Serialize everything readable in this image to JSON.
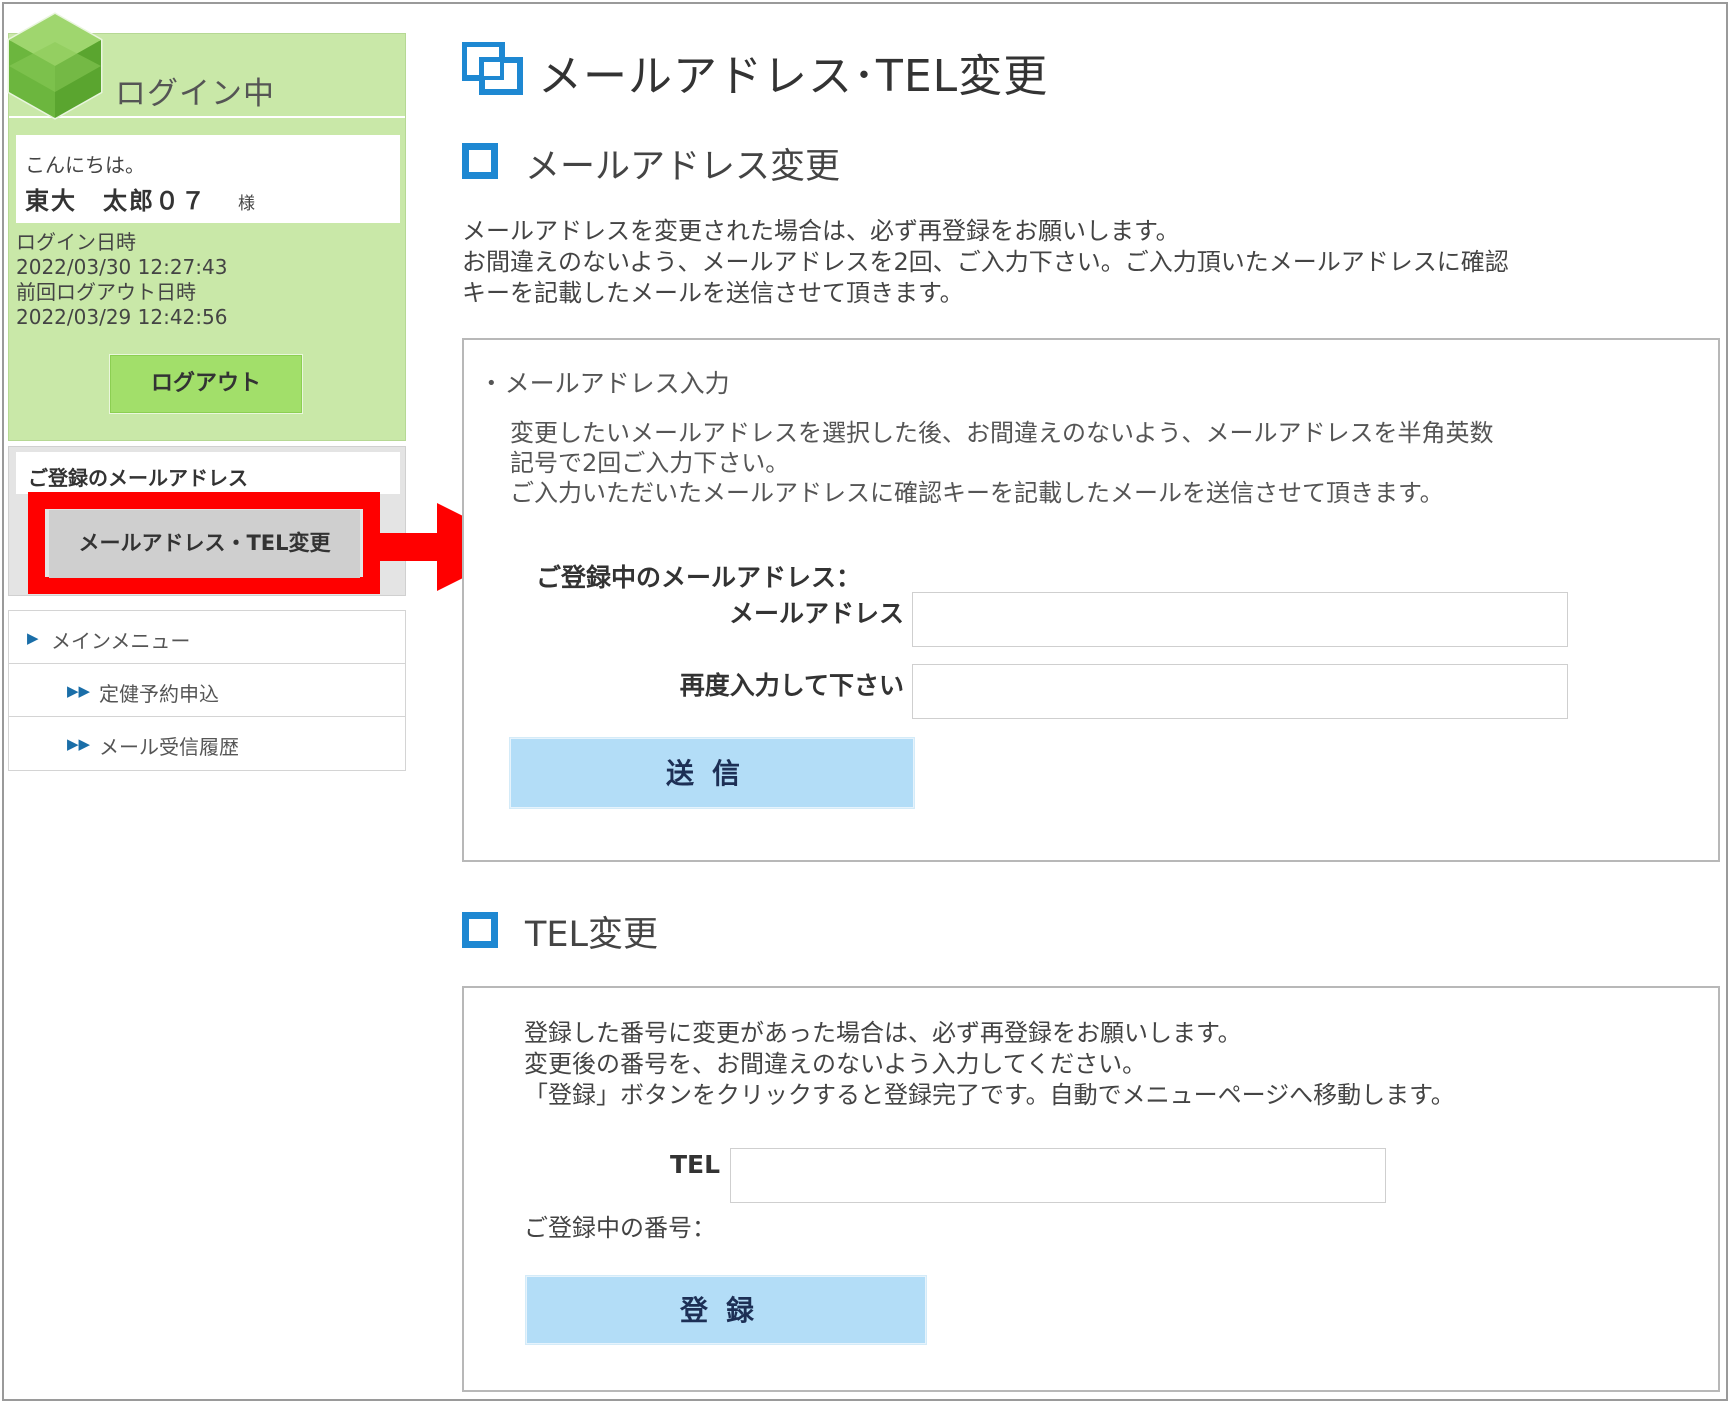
{
  "sidebar": {
    "login_title": "ログイン中",
    "greeting": "こんにちは。",
    "user_name": "東大　太郎０７",
    "honorific": "様",
    "login_time_label": "ログイン日時",
    "login_time": "2022/03/30 12:27:43",
    "last_logout_label": "前回ログアウト日時",
    "last_logout": "2022/03/29 12:42:56",
    "logout_button": "ログアウト",
    "registered_email_title": "ご登録のメールアドレス",
    "email_tel_change_button": "メールアドレス・TEL変更",
    "menu": [
      {
        "label": "メインメニュー"
      },
      {
        "label": "定健予約申込"
      },
      {
        "label": "メール受信履歴"
      }
    ]
  },
  "main": {
    "page_title": "メールアドレス･TEL変更",
    "email_section": {
      "heading": "メールアドレス変更",
      "intro": [
        "メールアドレスを変更された場合は、必ず再登録をお願いします。",
        "お間違えのないよう、メールアドレスを2回、ご入力下さい。ご入力頂いたメールアドレスに確認",
        "キーを記載したメールを送信させて頂きます。"
      ],
      "input_title": "メールアドレス入力",
      "desc": [
        "変更したいメールアドレスを選択した後、お間違えのないよう、メールアドレスを半角英数",
        "記号で2回ご入力下さい。",
        "ご入力いただいたメールアドレスに確認キーを記載したメールを送信させて頂きます。"
      ],
      "current_email_label": "ご登録中のメールアドレス：",
      "email_label": "メールアドレス",
      "email_value": "",
      "confirm_label": "再度入力して下さい",
      "confirm_value": "",
      "submit_button": "送信"
    },
    "tel_section": {
      "heading": "TEL変更",
      "desc": [
        "登録した番号に変更があった場合は、必ず再登録をお願いします。",
        "変更後の番号を、お間違えのないよう入力してください。",
        "「登録」ボタンをクリックすると登録完了です。自動でメニューページへ移動します。"
      ],
      "tel_label": "TEL",
      "tel_value": "",
      "current_number_label": "ご登録中の番号：",
      "register_button": "登録"
    }
  },
  "colors": {
    "login_green": "#c9e8a8",
    "logout_button": "#a2df6a",
    "accent_blue": "#1e88d2",
    "button_blue": "#b3ddf7",
    "highlight_red": "#ff0000"
  }
}
